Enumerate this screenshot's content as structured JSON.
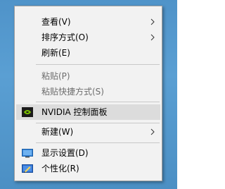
{
  "menu": {
    "items": [
      {
        "label": "查看(V)",
        "submenu": true
      },
      {
        "label": "排序方式(O)",
        "submenu": true
      },
      {
        "label": "刷新(E)"
      },
      {
        "label": "粘贴(P)",
        "disabled": true
      },
      {
        "label": "粘贴快捷方式(S)",
        "disabled": true
      },
      {
        "label": "NVIDIA 控制面板",
        "icon": "nvidia-icon",
        "highlighted": true
      },
      {
        "label": "新建(W)",
        "submenu": true
      },
      {
        "label": "显示设置(D)",
        "icon": "display-icon"
      },
      {
        "label": "个性化(R)",
        "icon": "personalize-icon"
      }
    ]
  },
  "colors": {
    "menu_bg": "#f2f2f2",
    "highlight": "#dcdcdc",
    "disabled_text": "#6d6d6d",
    "desktop_bg": "#4f93c9"
  }
}
